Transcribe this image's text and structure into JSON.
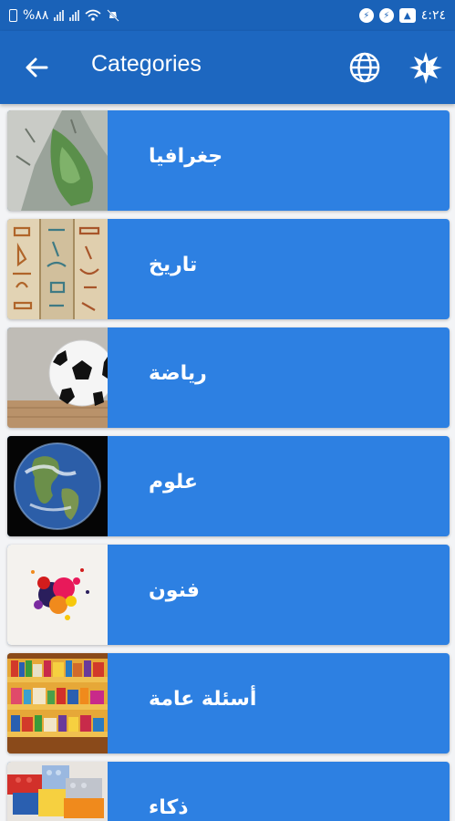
{
  "status_bar": {
    "battery": "%٨٨",
    "time": "٤:٢٤"
  },
  "app_bar": {
    "title": "Categories"
  },
  "categories": [
    {
      "label": "جغرافيا"
    },
    {
      "label": "تاريخ"
    },
    {
      "label": "رياضة"
    },
    {
      "label": "علوم"
    },
    {
      "label": "فنون"
    },
    {
      "label": "أسئلة عامة"
    },
    {
      "label": "ذكاء"
    }
  ],
  "colors": {
    "status_bar": "#1a62b8",
    "app_bar": "#1d67c0",
    "card": "#2d80e2",
    "background": "#f3f4f6"
  }
}
